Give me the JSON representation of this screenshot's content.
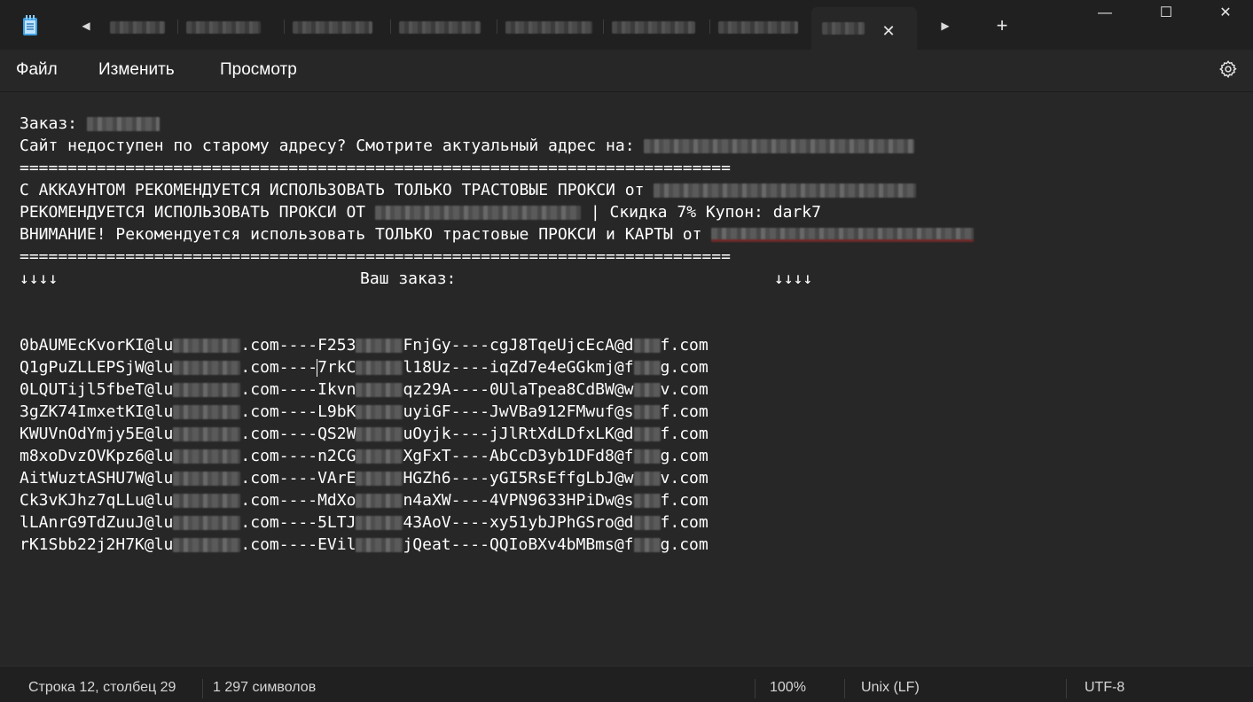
{
  "titlebar": {
    "tabs_count_visible": 8,
    "new_tab_label": "+",
    "controls": {
      "minimize": "—",
      "maximize": "☐",
      "close": "✕"
    },
    "close_tab_label": "✕"
  },
  "menu": {
    "items": [
      {
        "label": "Файл"
      },
      {
        "label": "Изменить"
      },
      {
        "label": "Просмотр"
      }
    ],
    "settings_icon": "gear-icon"
  },
  "editor": {
    "order_label": "Заказ:",
    "site_notice": "Сайт недоступен по старому адресу? Смотрите актуальный адрес на:",
    "separator": "==========================================================================",
    "line_account": "С АККАУНТОМ РЕКОМЕНДУЕТСЯ ИСПОЛЬЗОВАТЬ ТОЛЬКО ТРАСТОВЫЕ ПРОКСИ от",
    "line_proxy": "РЕКОМЕНДУЕТСЯ ИСПОЛЬЗОВАТЬ ПРОКСИ ОТ",
    "line_proxy_suffix": "| Скидка 7% Купон: dark7",
    "line_warning": "ВНИМАНИЕ! Рекомендуется использовать ТОЛЬКО трастовые ПРОКСИ и КАРТЫ от",
    "arrows_left": "↓↓↓↓",
    "your_order": "Ваш заказ:",
    "arrows_right": "↓↓↓↓",
    "accounts": [
      {
        "user": "0bAUMEcKvorKI@lu",
        "dom": ".com----F253",
        "mid": "FnjGy----cgJ8TqeUjcEcA@d",
        "end": "f.com"
      },
      {
        "user": "Q1gPuZLLEPSjW@lu",
        "dom": ".com----",
        "dom2": "7rkC",
        "mid": "l18Uz----iqZd7e4eGGkmj@f",
        "end": "g.com"
      },
      {
        "user": "0LQUTijl5fbeT@lu",
        "dom": ".com----Ikvn",
        "mid": "qz29A----0UlaTpea8CdBW@w",
        "end": "v.com"
      },
      {
        "user": "3gZK74ImxetKI@lu",
        "dom": ".com----L9bK",
        "mid": "uyiGF----JwVBa912FMwuf@s",
        "end": "f.com"
      },
      {
        "user": "KWUVnOdYmjy5E@lu",
        "dom": ".com----QS2W",
        "mid": "uOyjk----jJlRtXdLDfxLK@d",
        "end": "f.com"
      },
      {
        "user": "m8xoDvzOVKpz6@lu",
        "dom": ".com----n2CG",
        "mid": "XgFxT----AbCcD3yb1DFd8@f",
        "end": "g.com"
      },
      {
        "user": "AitWuztASHU7W@lu",
        "dom": ".com----VArE",
        "mid": "HGZh6----yGI5RsEffgLbJ@w",
        "end": "v.com"
      },
      {
        "user": "Ck3vKJhz7qLLu@lu",
        "dom": ".com----MdXo",
        "mid": "n4aXW----4VPN9633HPiDw@s",
        "end": "f.com"
      },
      {
        "user": "lLAnrG9TdZuuJ@lu",
        "dom": ".com----5LTJ",
        "mid": "43AoV----xy51ybJPhGSro@d",
        "end": "f.com"
      },
      {
        "user": "rK1Sbb22j2H7K@lu",
        "dom": ".com----EVil",
        "mid": "jQeat----QQIoBXv4bMBms@f",
        "end": "g.com"
      }
    ]
  },
  "status": {
    "position": "Строка 12, столбец 29",
    "chars": "1 297 символов",
    "zoom": "100%",
    "line_endings": "Unix (LF)",
    "encoding": "UTF-8"
  }
}
